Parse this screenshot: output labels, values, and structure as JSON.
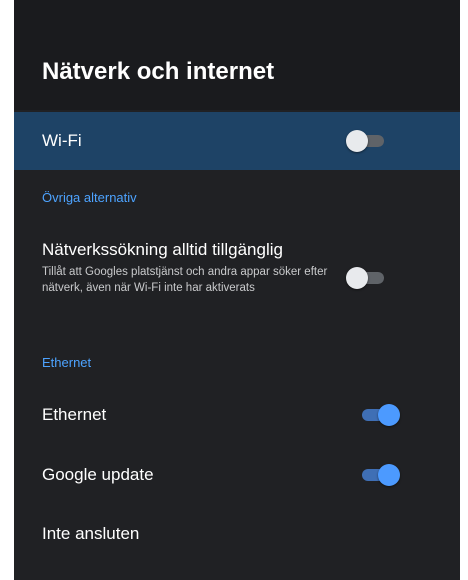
{
  "header": {
    "title": "Nätverk och internet"
  },
  "wifi": {
    "label": "Wi-Fi",
    "toggle": "off"
  },
  "other_options": {
    "header": "Övriga alternativ",
    "network_scan": {
      "title": "Nätverkssökning alltid tillgänglig",
      "description": "Tillåt att Googles platstjänst och andra appar söker efter nätverk, även när Wi-Fi inte har aktiverats",
      "toggle": "off"
    }
  },
  "ethernet_section": {
    "header": "Ethernet",
    "ethernet": {
      "label": "Ethernet",
      "toggle": "on"
    },
    "google_update": {
      "label": "Google update",
      "toggle": "on"
    },
    "status": "Inte ansluten"
  },
  "colors": {
    "background": "#202124",
    "header_background": "#1a1b1e",
    "selected_row": "#1e4366",
    "section_header": "#4da3ff",
    "toggle_on": "#4c9aff",
    "toggle_off": "#e8eaed"
  }
}
